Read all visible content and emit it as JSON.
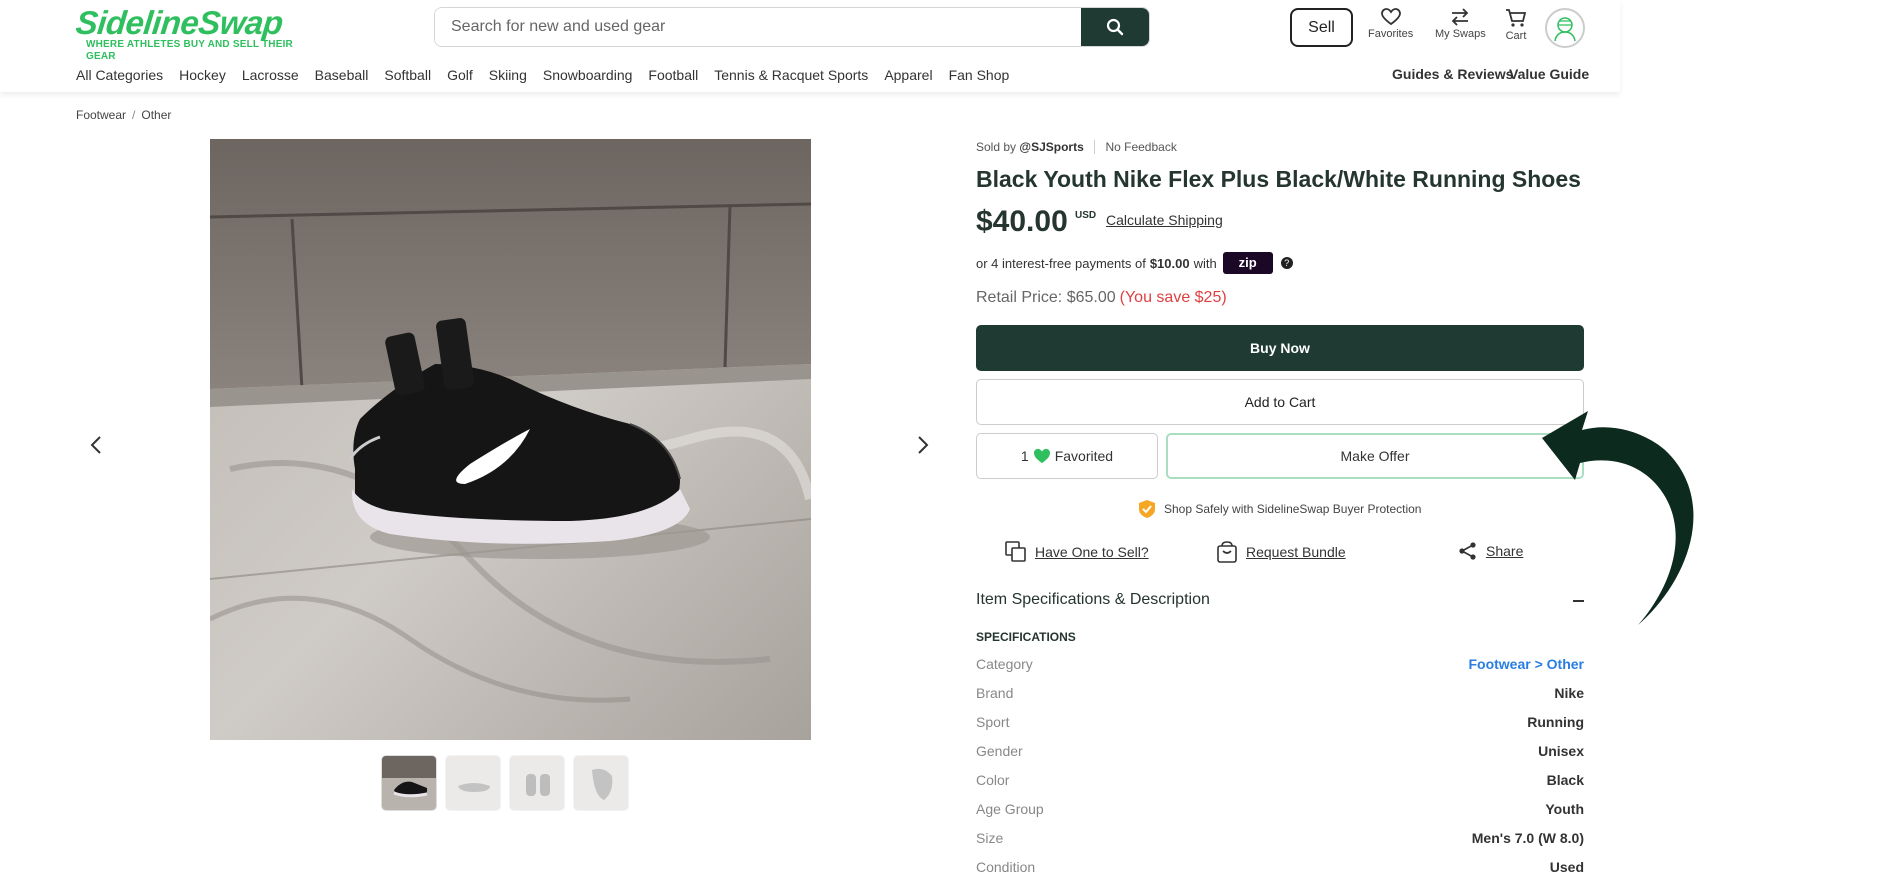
{
  "header": {
    "logo": "SidelineSwap",
    "tagline": "WHERE ATHLETES BUY AND SELL THEIR GEAR",
    "search_placeholder": "Search for new and used gear",
    "sell_label": "Sell",
    "favorites_label": "Favorites",
    "myswaps_label": "My Swaps",
    "cart_label": "Cart"
  },
  "nav": {
    "items": [
      "All Categories",
      "Hockey",
      "Lacrosse",
      "Baseball",
      "Softball",
      "Golf",
      "Skiing",
      "Snowboarding",
      "Football",
      "Tennis & Racquet Sports",
      "Apparel",
      "Fan Shop"
    ],
    "guides": "Guides & Reviews",
    "value_guide": "Value Guide"
  },
  "breadcrumb": [
    "Footwear",
    "Other"
  ],
  "product": {
    "sold_by": "Sold by",
    "seller": "@SJSports",
    "feedback": "No Feedback",
    "title": "Black Youth Nike Flex Plus Black/White Running Shoes",
    "price": "$40.00",
    "currency": "USD",
    "calc_shipping": "Calculate Shipping",
    "installment_prefix": "or 4 interest-free payments of",
    "installment_amount": "$10.00",
    "installment_suffix": "with",
    "zip_label": "zip",
    "retail_price": "Retail Price: $65.00",
    "savings": "(You save $25)"
  },
  "buttons": {
    "buy_now": "Buy Now",
    "add_to_cart": "Add to Cart",
    "favorite_count": "1",
    "favorited": "Favorited",
    "make_offer": "Make Offer"
  },
  "protection": "Shop Safely with SidelineSwap Buyer Protection",
  "actions": {
    "have_one": "Have One to Sell?",
    "request_bundle": "Request Bundle",
    "share": "Share"
  },
  "specs": {
    "heading": "Item Specifications & Description",
    "subheading": "SPECIFICATIONS",
    "rows": [
      {
        "key": "Category",
        "value": "Footwear > Other"
      },
      {
        "key": "Brand",
        "value": "Nike"
      },
      {
        "key": "Sport",
        "value": "Running"
      },
      {
        "key": "Gender",
        "value": "Unisex"
      },
      {
        "key": "Color",
        "value": "Black"
      },
      {
        "key": "Age Group",
        "value": "Youth"
      },
      {
        "key": "Size",
        "value": "Men's 7.0 (W 8.0)"
      },
      {
        "key": "Condition",
        "value": "Used"
      }
    ]
  },
  "colors": {
    "brand_green": "#2fbf5e",
    "dark_green": "#1e3a32",
    "save_red": "#e04040",
    "link_blue": "#2a7de1"
  }
}
